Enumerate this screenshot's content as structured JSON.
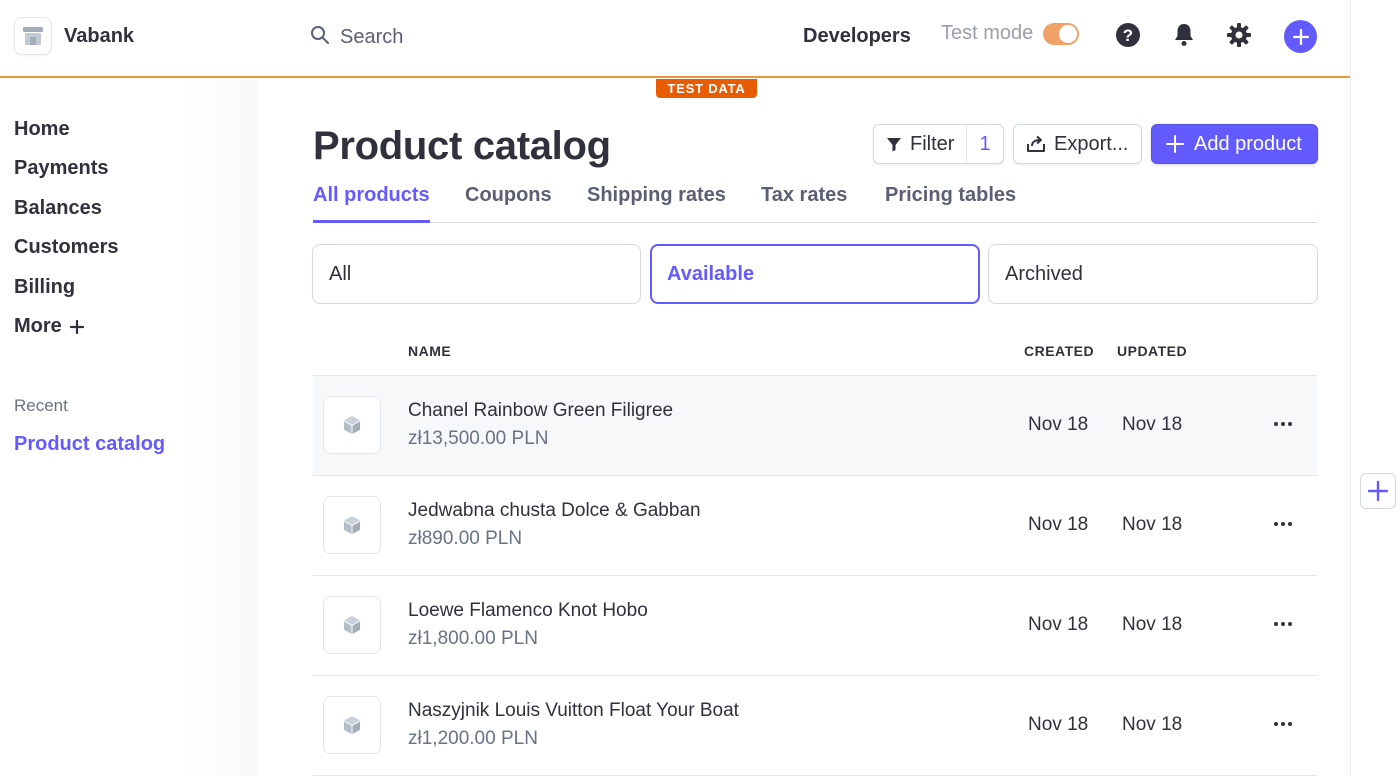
{
  "header": {
    "brand_name": "Vabank",
    "search_placeholder": "Search",
    "developers_label": "Developers",
    "test_mode_label": "Test mode",
    "test_mode_on": true,
    "test_data_badge": "TEST DATA"
  },
  "sidebar": {
    "items": [
      {
        "label": "Home"
      },
      {
        "label": "Payments"
      },
      {
        "label": "Balances"
      },
      {
        "label": "Customers"
      },
      {
        "label": "Billing"
      },
      {
        "label": "More"
      }
    ],
    "recent_heading": "Recent",
    "recent_items": [
      {
        "label": "Product catalog"
      }
    ]
  },
  "main": {
    "title": "Product catalog",
    "filter_label": "Filter",
    "filter_count": "1",
    "export_label": "Export...",
    "add_label": "Add product",
    "tabs": [
      {
        "label": "All products",
        "active": true
      },
      {
        "label": "Coupons"
      },
      {
        "label": "Shipping rates"
      },
      {
        "label": "Tax rates"
      },
      {
        "label": "Pricing tables"
      }
    ],
    "segments": [
      {
        "label": "All"
      },
      {
        "label": "Available",
        "active": true
      },
      {
        "label": "Archived"
      }
    ],
    "table": {
      "headers": {
        "name": "NAME",
        "created": "CREATED",
        "updated": "UPDATED"
      },
      "rows": [
        {
          "name": "Chanel Rainbow Green Filigree",
          "price": "zł13,500.00 PLN",
          "created": "Nov 18",
          "updated": "Nov 18"
        },
        {
          "name": "Jedwabna chusta Dolce & Gabban",
          "price": "zł890.00 PLN",
          "created": "Nov 18",
          "updated": "Nov 18"
        },
        {
          "name": "Loewe Flamenco Knot Hobo",
          "price": "zł1,800.00 PLN",
          "created": "Nov 18",
          "updated": "Nov 18"
        },
        {
          "name": "Naszyjnik Louis Vuitton Float Your Boat",
          "price": "zł1,200.00 PLN",
          "created": "Nov 18",
          "updated": "Nov 18"
        }
      ]
    }
  },
  "colors": {
    "accent": "#635bff",
    "test_mode_orange": "#e85d04",
    "text": "#30313d",
    "muted": "#687385"
  },
  "icons": {
    "brand": "store-icon",
    "search": "search-icon",
    "help": "help-icon",
    "notifications": "bell-icon",
    "settings": "gear-icon",
    "create": "plus-icon",
    "filter": "filter-icon",
    "export": "export-icon",
    "product": "cube-icon",
    "row_menu": "more-horizontal-icon"
  }
}
